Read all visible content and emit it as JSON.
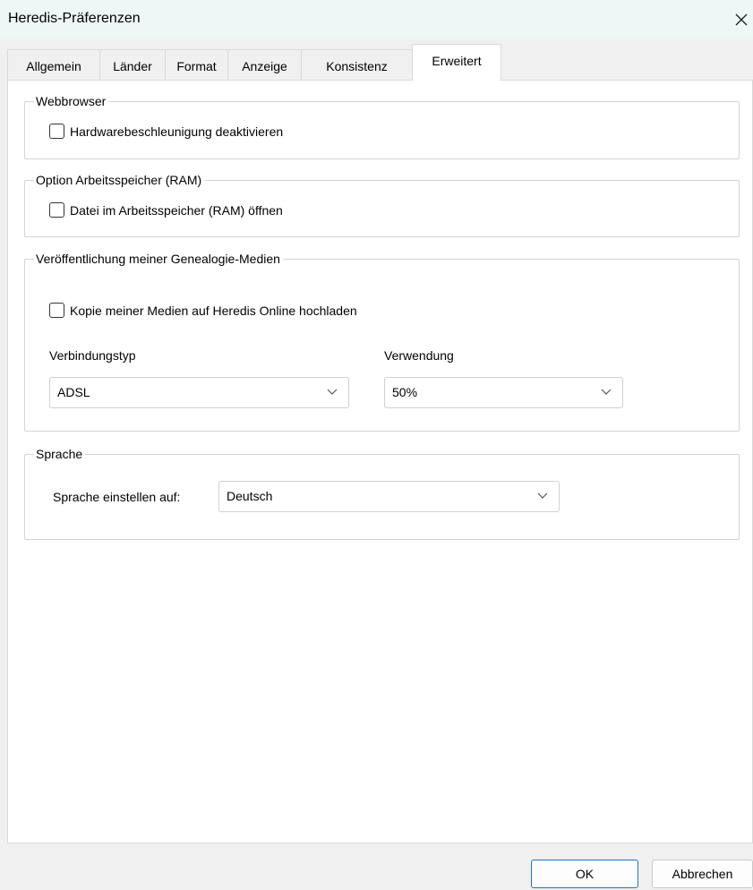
{
  "window": {
    "title": "Heredis-Präferenzen",
    "close_icon": "close-icon"
  },
  "tabs": [
    {
      "label": "Allgemein"
    },
    {
      "label": "Länder"
    },
    {
      "label": "Format"
    },
    {
      "label": "Anzeige"
    },
    {
      "label": "Konsistenz"
    },
    {
      "label": "Erweitert",
      "active": true
    }
  ],
  "webbrowser": {
    "legend": "Webbrowser",
    "hardware_accel_label": "Hardwarebeschleunigung deaktivieren",
    "hardware_accel_checked": false
  },
  "ram": {
    "legend": "Option Arbeitsspeicher (RAM)",
    "open_in_ram_label": "Datei im Arbeitsspeicher (RAM) öffnen",
    "open_in_ram_checked": false
  },
  "media": {
    "legend": "Veröffentlichung meiner Genealogie-Medien",
    "upload_label": "Kopie meiner Medien auf Heredis Online hochladen",
    "upload_checked": false,
    "connection_label": "Verbindungstyp",
    "connection_value": "ADSL",
    "usage_label": "Verwendung",
    "usage_value": "50%"
  },
  "language": {
    "legend": "Sprache",
    "set_label": "Sprache einstellen auf:",
    "value": "Deutsch"
  },
  "buttons": {
    "ok": "OK",
    "cancel": "Abbrechen"
  }
}
